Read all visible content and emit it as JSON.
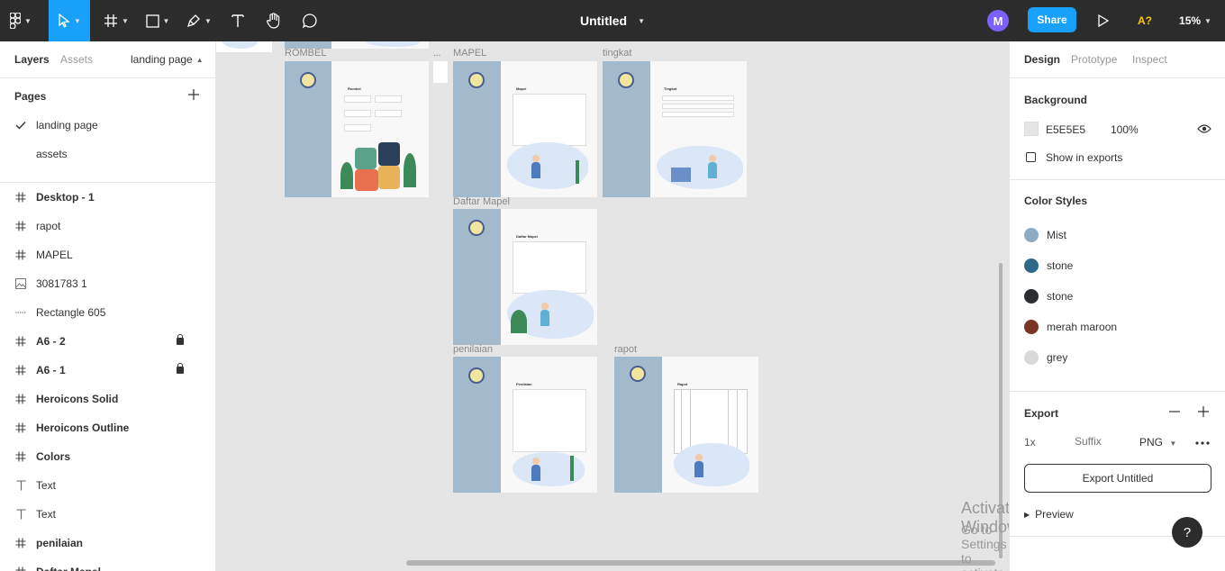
{
  "topbar": {
    "title": "Untitled",
    "avatar_letter": "M",
    "share_label": "Share",
    "a11y_label": "A?",
    "zoom": "15%"
  },
  "left_panel": {
    "tabs": {
      "layers": "Layers",
      "assets": "Assets",
      "page_switch": "landing page"
    },
    "pages_title": "Pages",
    "pages": [
      {
        "name": "landing page",
        "current": true
      },
      {
        "name": "assets",
        "current": false
      }
    ],
    "layers": [
      {
        "name": "Desktop - 1",
        "icon": "frame-icon",
        "bold": true,
        "locked": false
      },
      {
        "name": "rapot",
        "icon": "frame-icon",
        "bold": false,
        "locked": false
      },
      {
        "name": "MAPEL",
        "icon": "frame-icon",
        "bold": false,
        "locked": false
      },
      {
        "name": "3081783 1",
        "icon": "image-icon",
        "bold": false,
        "locked": false
      },
      {
        "name": "Rectangle 605",
        "icon": "rectangle-icon",
        "bold": false,
        "locked": false
      },
      {
        "name": "A6 - 2",
        "icon": "frame-icon",
        "bold": true,
        "locked": true
      },
      {
        "name": "A6 - 1",
        "icon": "frame-icon",
        "bold": true,
        "locked": true
      },
      {
        "name": "Heroicons Solid",
        "icon": "frame-icon",
        "bold": true,
        "locked": false
      },
      {
        "name": "Heroicons Outline",
        "icon": "frame-icon",
        "bold": true,
        "locked": false
      },
      {
        "name": "Colors",
        "icon": "frame-icon",
        "bold": true,
        "locked": false
      },
      {
        "name": "Text",
        "icon": "text-icon",
        "bold": false,
        "locked": false
      },
      {
        "name": "Text",
        "icon": "text-icon",
        "bold": false,
        "locked": false
      },
      {
        "name": "penilaian",
        "icon": "frame-icon",
        "bold": true,
        "locked": false
      },
      {
        "name": "Daftar Mapel",
        "icon": "frame-icon",
        "bold": true,
        "locked": false
      }
    ]
  },
  "right_panel": {
    "tabs": {
      "design": "Design",
      "prototype": "Prototype",
      "inspect": "Inspect"
    },
    "background": {
      "title": "Background",
      "hex": "E5E5E5",
      "opacity": "100%",
      "swatch_color": "#E5E5E5"
    },
    "show_in_exports": "Show in exports",
    "color_styles": {
      "title": "Color Styles",
      "items": [
        {
          "name": "Mist",
          "color": "#8EABC4"
        },
        {
          "name": "stone",
          "color": "#2D6A8A"
        },
        {
          "name": "stone",
          "color": "#2B2E30"
        },
        {
          "name": "merah maroon",
          "color": "#7A3526"
        },
        {
          "name": "grey",
          "color": "#D9D9D9"
        }
      ]
    },
    "export": {
      "title": "Export",
      "scale": "1x",
      "suffix_placeholder": "Suffix",
      "format": "PNG",
      "button": "Export Untitled",
      "preview": "Preview"
    }
  },
  "canvas": {
    "frames": {
      "rombel": "ROMBEL",
      "mapel": "MAPEL",
      "tingkat": "tingkat",
      "daftar_mapel": "Daftar Mapel",
      "penilaian": "penilaian",
      "rapot": "rapot"
    },
    "frame_headings": {
      "rombel": "Rombel",
      "mapel": "Mapel",
      "tingkat": "Tingkat",
      "daftar_mapel": "Daftar Mapel",
      "penilaian": "Penilaian",
      "rapot": "Rapot"
    },
    "ellipsis": "..."
  },
  "watermark": {
    "line1": "Activate Windows",
    "line2": "Go to Settings to activate Windows."
  },
  "help_label": "?"
}
